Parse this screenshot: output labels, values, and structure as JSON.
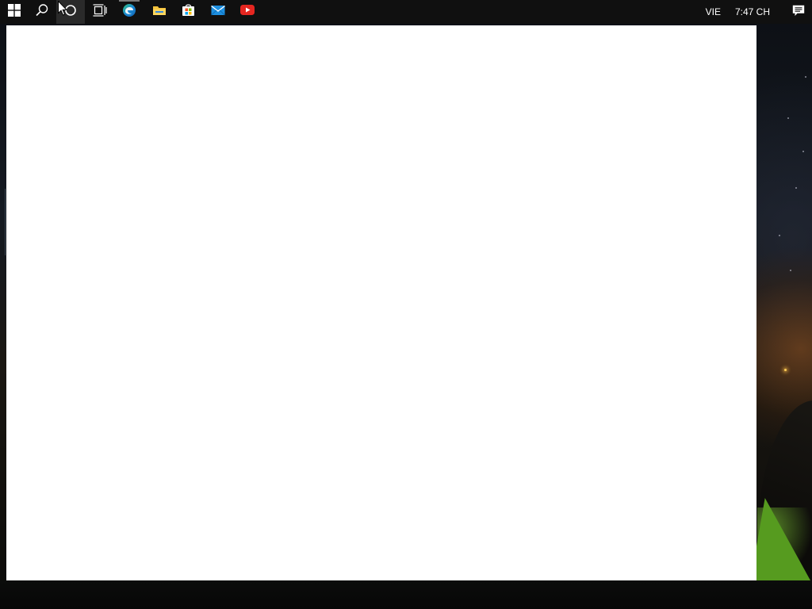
{
  "taskbar": {
    "icons": {
      "start": "windows-start-icon",
      "search": "search-icon",
      "cortana": "cortana-circle-icon",
      "task_view": "task-view-icon",
      "edge": "edge-browser-icon",
      "file_explorer": "file-explorer-icon",
      "store": "microsoft-store-icon",
      "mail": "mail-icon",
      "youtube": "youtube-icon"
    },
    "tray": {
      "language": "VIE",
      "clock": "7:47 CH",
      "notification_icon": "action-center-icon"
    }
  },
  "colors": {
    "taskbar_bg": "#101010",
    "window_bg": "#ffffff",
    "edge_blue": "#1a8ad4",
    "edge_green": "#35c27a",
    "folder_yellow": "#f5c33b",
    "store_blue": "#1f6fd0",
    "mail_blue": "#1d8fe0",
    "youtube_red": "#e52620"
  }
}
